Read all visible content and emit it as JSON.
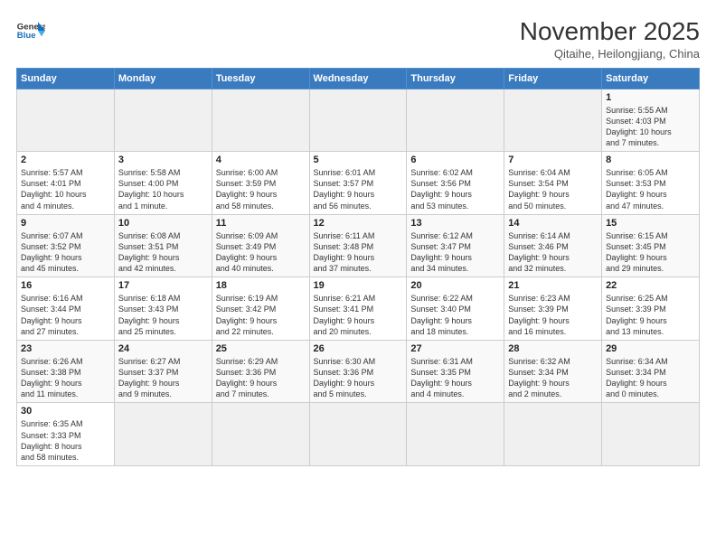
{
  "header": {
    "logo_general": "General",
    "logo_blue": "Blue",
    "month": "November 2025",
    "location": "Qitaihe, Heilongjiang, China"
  },
  "weekdays": [
    "Sunday",
    "Monday",
    "Tuesday",
    "Wednesday",
    "Thursday",
    "Friday",
    "Saturday"
  ],
  "weeks": [
    [
      {
        "day": "",
        "info": ""
      },
      {
        "day": "",
        "info": ""
      },
      {
        "day": "",
        "info": ""
      },
      {
        "day": "",
        "info": ""
      },
      {
        "day": "",
        "info": ""
      },
      {
        "day": "",
        "info": ""
      },
      {
        "day": "1",
        "info": "Sunrise: 5:55 AM\nSunset: 4:03 PM\nDaylight: 10 hours\nand 7 minutes."
      }
    ],
    [
      {
        "day": "2",
        "info": "Sunrise: 5:57 AM\nSunset: 4:01 PM\nDaylight: 10 hours\nand 4 minutes."
      },
      {
        "day": "3",
        "info": "Sunrise: 5:58 AM\nSunset: 4:00 PM\nDaylight: 10 hours\nand 1 minute."
      },
      {
        "day": "4",
        "info": "Sunrise: 6:00 AM\nSunset: 3:59 PM\nDaylight: 9 hours\nand 58 minutes."
      },
      {
        "day": "5",
        "info": "Sunrise: 6:01 AM\nSunset: 3:57 PM\nDaylight: 9 hours\nand 56 minutes."
      },
      {
        "day": "6",
        "info": "Sunrise: 6:02 AM\nSunset: 3:56 PM\nDaylight: 9 hours\nand 53 minutes."
      },
      {
        "day": "7",
        "info": "Sunrise: 6:04 AM\nSunset: 3:54 PM\nDaylight: 9 hours\nand 50 minutes."
      },
      {
        "day": "8",
        "info": "Sunrise: 6:05 AM\nSunset: 3:53 PM\nDaylight: 9 hours\nand 47 minutes."
      }
    ],
    [
      {
        "day": "9",
        "info": "Sunrise: 6:07 AM\nSunset: 3:52 PM\nDaylight: 9 hours\nand 45 minutes."
      },
      {
        "day": "10",
        "info": "Sunrise: 6:08 AM\nSunset: 3:51 PM\nDaylight: 9 hours\nand 42 minutes."
      },
      {
        "day": "11",
        "info": "Sunrise: 6:09 AM\nSunset: 3:49 PM\nDaylight: 9 hours\nand 40 minutes."
      },
      {
        "day": "12",
        "info": "Sunrise: 6:11 AM\nSunset: 3:48 PM\nDaylight: 9 hours\nand 37 minutes."
      },
      {
        "day": "13",
        "info": "Sunrise: 6:12 AM\nSunset: 3:47 PM\nDaylight: 9 hours\nand 34 minutes."
      },
      {
        "day": "14",
        "info": "Sunrise: 6:14 AM\nSunset: 3:46 PM\nDaylight: 9 hours\nand 32 minutes."
      },
      {
        "day": "15",
        "info": "Sunrise: 6:15 AM\nSunset: 3:45 PM\nDaylight: 9 hours\nand 29 minutes."
      }
    ],
    [
      {
        "day": "16",
        "info": "Sunrise: 6:16 AM\nSunset: 3:44 PM\nDaylight: 9 hours\nand 27 minutes."
      },
      {
        "day": "17",
        "info": "Sunrise: 6:18 AM\nSunset: 3:43 PM\nDaylight: 9 hours\nand 25 minutes."
      },
      {
        "day": "18",
        "info": "Sunrise: 6:19 AM\nSunset: 3:42 PM\nDaylight: 9 hours\nand 22 minutes."
      },
      {
        "day": "19",
        "info": "Sunrise: 6:21 AM\nSunset: 3:41 PM\nDaylight: 9 hours\nand 20 minutes."
      },
      {
        "day": "20",
        "info": "Sunrise: 6:22 AM\nSunset: 3:40 PM\nDaylight: 9 hours\nand 18 minutes."
      },
      {
        "day": "21",
        "info": "Sunrise: 6:23 AM\nSunset: 3:39 PM\nDaylight: 9 hours\nand 16 minutes."
      },
      {
        "day": "22",
        "info": "Sunrise: 6:25 AM\nSunset: 3:39 PM\nDaylight: 9 hours\nand 13 minutes."
      }
    ],
    [
      {
        "day": "23",
        "info": "Sunrise: 6:26 AM\nSunset: 3:38 PM\nDaylight: 9 hours\nand 11 minutes."
      },
      {
        "day": "24",
        "info": "Sunrise: 6:27 AM\nSunset: 3:37 PM\nDaylight: 9 hours\nand 9 minutes."
      },
      {
        "day": "25",
        "info": "Sunrise: 6:29 AM\nSunset: 3:36 PM\nDaylight: 9 hours\nand 7 minutes."
      },
      {
        "day": "26",
        "info": "Sunrise: 6:30 AM\nSunset: 3:36 PM\nDaylight: 9 hours\nand 5 minutes."
      },
      {
        "day": "27",
        "info": "Sunrise: 6:31 AM\nSunset: 3:35 PM\nDaylight: 9 hours\nand 4 minutes."
      },
      {
        "day": "28",
        "info": "Sunrise: 6:32 AM\nSunset: 3:34 PM\nDaylight: 9 hours\nand 2 minutes."
      },
      {
        "day": "29",
        "info": "Sunrise: 6:34 AM\nSunset: 3:34 PM\nDaylight: 9 hours\nand 0 minutes."
      }
    ],
    [
      {
        "day": "30",
        "info": "Sunrise: 6:35 AM\nSunset: 3:33 PM\nDaylight: 8 hours\nand 58 minutes."
      },
      {
        "day": "",
        "info": ""
      },
      {
        "day": "",
        "info": ""
      },
      {
        "day": "",
        "info": ""
      },
      {
        "day": "",
        "info": ""
      },
      {
        "day": "",
        "info": ""
      },
      {
        "day": "",
        "info": ""
      }
    ]
  ]
}
